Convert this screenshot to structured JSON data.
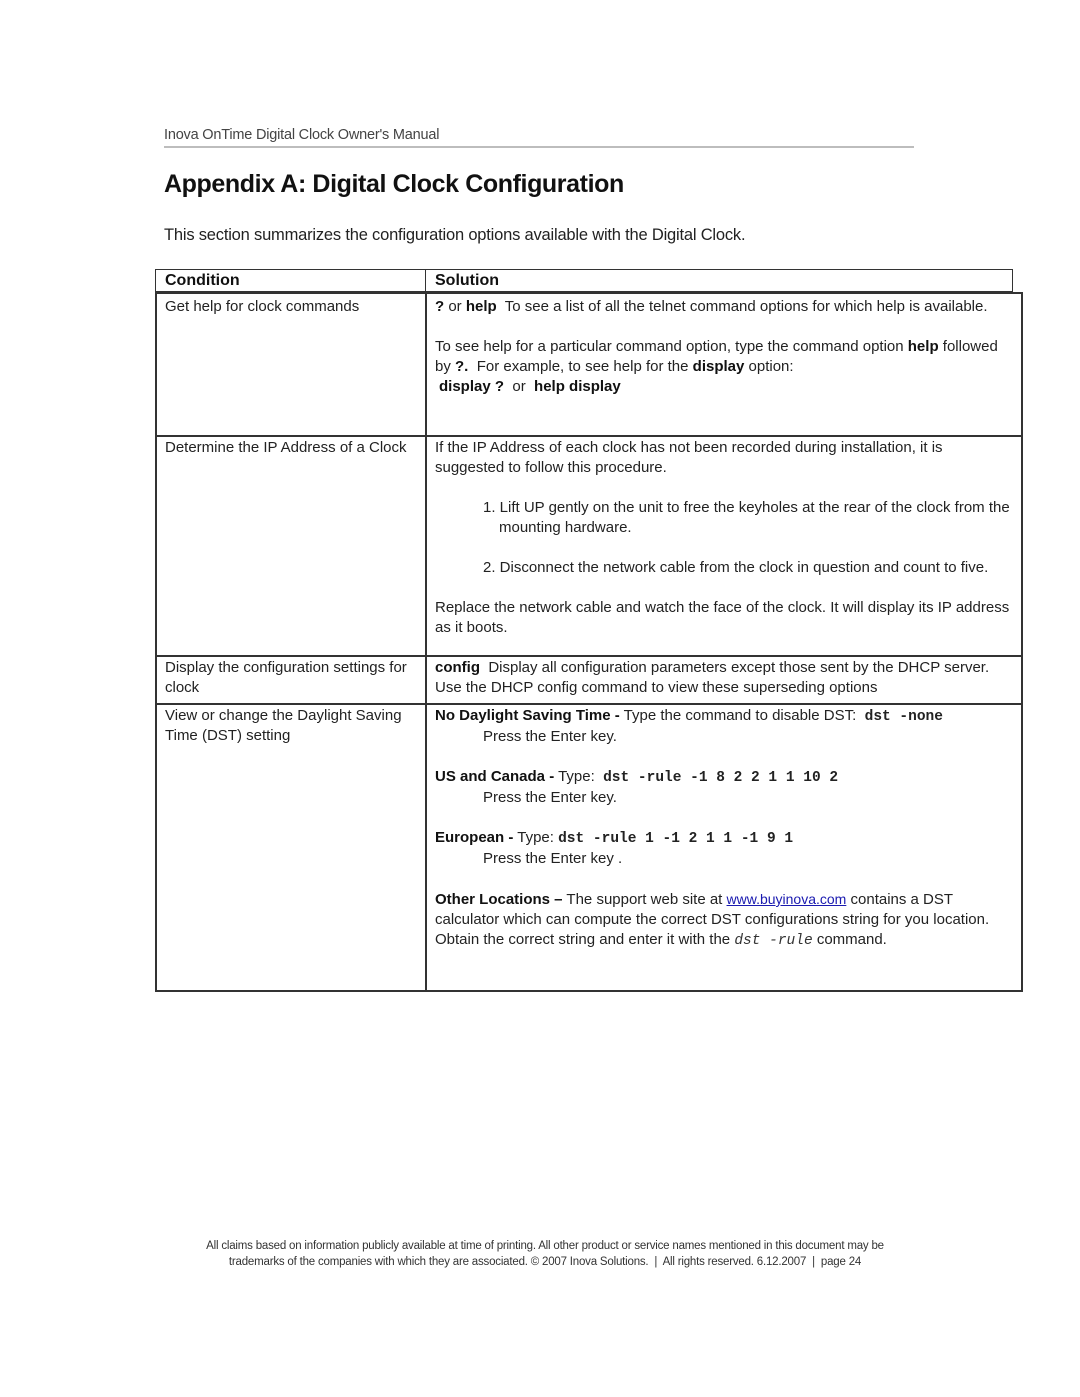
{
  "header": {
    "running_title": "Inova OnTime Digital Clock Owner's Manual"
  },
  "page": {
    "title": "Appendix A:  Digital Clock Configuration",
    "intro": "This section summarizes the configuration options available with the Digital Clock."
  },
  "table": {
    "columns": [
      "Condition",
      "Solution"
    ],
    "rows": [
      {
        "condition": "Get help for clock commands",
        "solution": {
          "p1_cmd1": "?",
          "p1_or": " or ",
          "p1_cmd2": "help",
          "p1_text": "  To see a list of all the telnet command options for which help is available.",
          "p2_text1": "To see help for a particular command option, type the command option ",
          "p2_bold1": "help",
          "p2_text2": " followed by ",
          "p2_bold2": "?.",
          "p2_text3": "  For example, to see help for the ",
          "p2_bold3": "display",
          "p2_text4": " option:",
          "p3_cmd1": "display ?",
          "p3_or": "  or  ",
          "p3_cmd2": "help display"
        }
      },
      {
        "condition": "Determine the IP Address of a Clock",
        "solution": {
          "intro": "If the IP Address of each clock has not been recorded during installation, it is suggested to follow this procedure.",
          "steps": [
            "1. Lift UP gently on the unit to free the keyholes at the rear of the clock from the mounting hardware.",
            "2. Disconnect the network cable from the clock in question and count to five."
          ],
          "outro": "Replace the network cable and watch the face of the clock.  It will display its IP address as it boots."
        }
      },
      {
        "condition": "Display the configuration settings for clock",
        "solution": {
          "cmd": "config",
          "text": "  Display all configuration parameters except those sent by the DHCP server.  Use the DHCP config command to view these superseding options"
        }
      },
      {
        "condition": "View or change the Daylight Saving Time (DST) setting",
        "solution": {
          "no_dst_label": "No Daylight Saving Time -",
          "no_dst_text": " Type the command to disable DST:  ",
          "no_dst_cmd": "dst -none",
          "press_enter": "Press the Enter key.",
          "us_label": "US and Canada -",
          "us_text": " Type:  ",
          "us_cmd": "dst -rule -1 8 2 2 1 1 10 2",
          "eu_label": "European -",
          "eu_text": " Type: ",
          "eu_cmd": "dst -rule 1 -1 2 1 1 -1 9 1",
          "press_enter_eu": "Press the Enter key .",
          "other_label": "Other Locations –",
          "other_text1": " The support web site at ",
          "other_link": "www.buyinova.com",
          "other_text2": " contains a DST calculator which can compute the correct DST configurations string for you location.  Obtain the correct string and enter it with the ",
          "other_cmd": "dst -rule",
          "other_text3": " command."
        }
      }
    ]
  },
  "footer": {
    "line1": "All claims based on information publicly available at time of printing. All other product or service names mentioned in this document may be",
    "line2": "trademarks of the companies with which they are associated. © 2007 Inova Solutions.  |  All rights reserved. 6.12.2007  |  page 24"
  }
}
